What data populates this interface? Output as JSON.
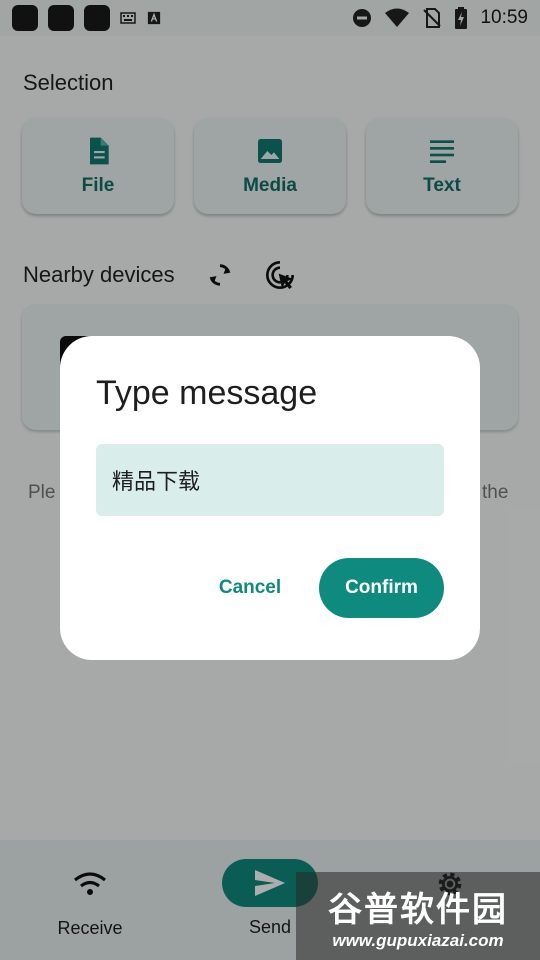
{
  "status_bar": {
    "time": "10:59",
    "colors": {
      "background": "#eef3f2"
    }
  },
  "selection": {
    "title": "Selection",
    "buttons": [
      {
        "label": "File",
        "icon": "file-icon"
      },
      {
        "label": "Media",
        "icon": "image-icon"
      },
      {
        "label": "Text",
        "icon": "text-lines-icon"
      }
    ]
  },
  "nearby": {
    "title": "Nearby devices",
    "refresh_icon": "refresh-icon",
    "scan_icon": "cursor-target-icon"
  },
  "hint": {
    "left_text": "Ple",
    "right_text": "the"
  },
  "bottom_nav": {
    "items": [
      {
        "label": "Receive",
        "icon": "wifi-icon"
      },
      {
        "label": "Send",
        "icon": "send-icon"
      },
      {
        "label": "",
        "icon": "gear-icon"
      }
    ]
  },
  "dialog": {
    "title": "Type message",
    "message_value": "精品下载",
    "cancel_label": "Cancel",
    "confirm_label": "Confirm"
  },
  "watermark": {
    "text": "谷普软件园",
    "url": "www.gupuxiazai.com"
  },
  "colors": {
    "accent": "#0f8a7e",
    "accent_text": "#136f66",
    "card_bg": "#eaf4f2",
    "field_bg": "#d9eeeb"
  }
}
